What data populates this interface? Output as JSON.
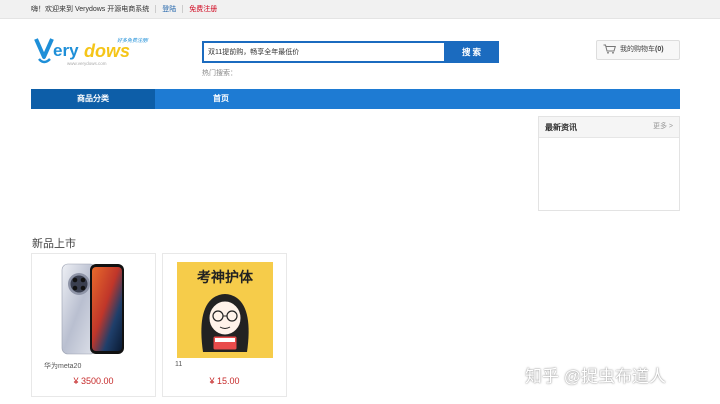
{
  "topbar": {
    "welcome": "嗨！欢迎来到 Verydows 开源电商系统",
    "login": "登陆",
    "register": "免费注册"
  },
  "header": {
    "logo_text": "Verydows",
    "logo_slogan": "好多免费注册!",
    "logo_url": "www.verydows.com",
    "search_placeholder": "双11提前购，畅享全年最低价",
    "search_button": "搜索",
    "hot_label": "热门搜索：",
    "cart_label": "我的购物车",
    "cart_count": "(0)"
  },
  "nav": {
    "category": "商品分类",
    "home": "首页"
  },
  "news": {
    "title": "最新资讯",
    "more": "更多 >"
  },
  "section": {
    "title": "新品上市"
  },
  "products": [
    {
      "name": "华为meta20",
      "price": "¥ 3500.00"
    },
    {
      "name": "11",
      "price": "¥ 15.00"
    }
  ],
  "product_art_text": "考神护体",
  "watermark": "知乎 @捉虫布道人",
  "colors": {
    "primary": "#1e7bd3",
    "nav_dark": "#0d5ea8",
    "price": "#c62a2a",
    "register": "#d0021b"
  }
}
